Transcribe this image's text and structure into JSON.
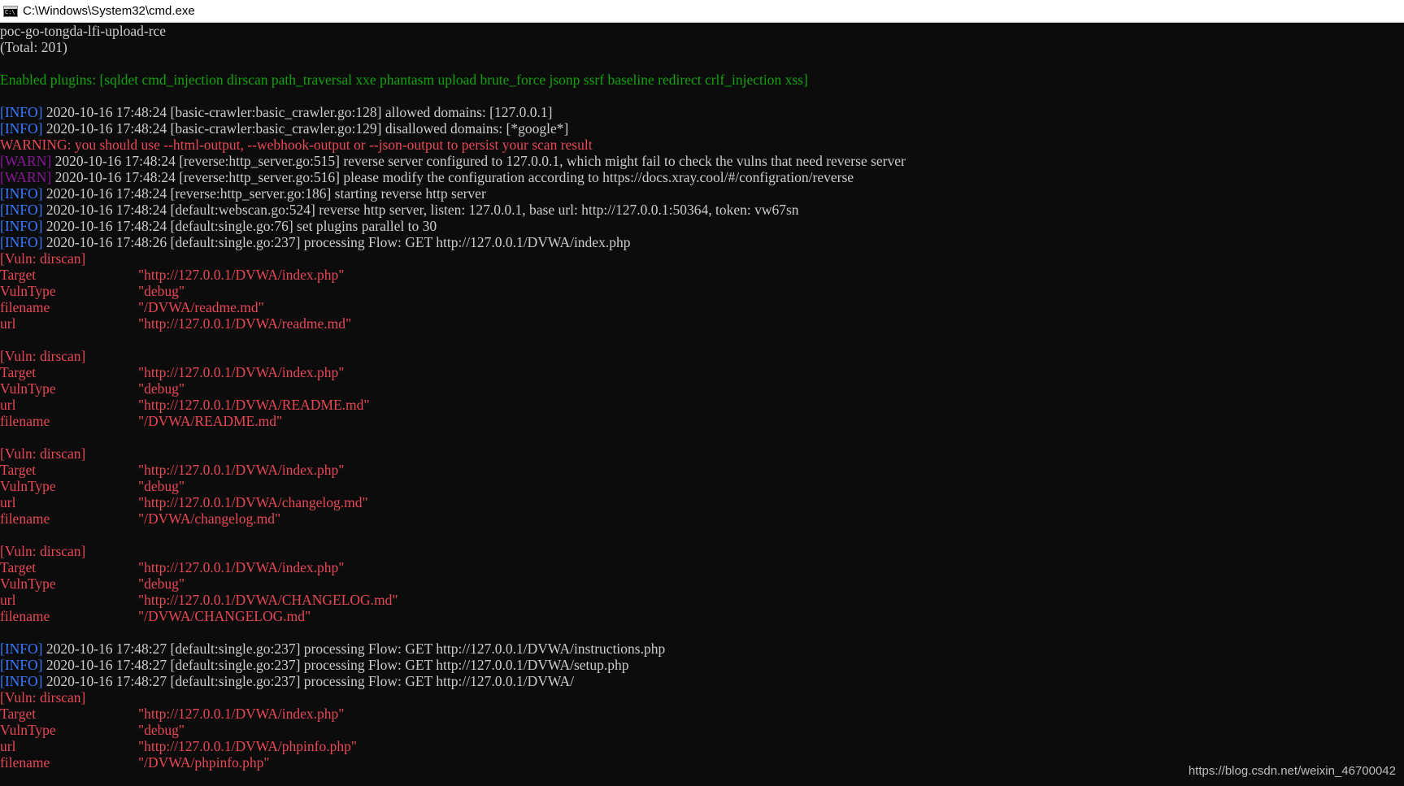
{
  "window": {
    "title": "C:\\Windows\\System32\\cmd.exe"
  },
  "colors": {
    "info": "#3b78ff",
    "warn": "#881798",
    "error": "#e74856",
    "plugins": "#13a10e",
    "text": "#cccccc",
    "background": "#0c0c0c"
  },
  "console": {
    "header": [
      "poc-go-tongda-lfi-upload-rce",
      "(Total: 201)"
    ],
    "plugins_line": "Enabled plugins: [sqldet cmd_injection dirscan path_traversal xxe phantasm upload brute_force jsonp ssrf baseline redirect crlf_injection xss]",
    "logs1": [
      {
        "tag": "[INFO]",
        "level": "info",
        "msg": " 2020-10-16 17:48:24 [basic-crawler:basic_crawler.go:128] allowed domains: [127.0.0.1]"
      },
      {
        "tag": "[INFO]",
        "level": "info",
        "msg": " 2020-10-16 17:48:24 [basic-crawler:basic_crawler.go:129] disallowed domains: [*google*]"
      }
    ],
    "warning": "WARNING: you should use --html-output, --webhook-output or --json-output to persist your scan result",
    "logs2": [
      {
        "tag": "[WARN]",
        "level": "warn",
        "msg": " 2020-10-16 17:48:24 [reverse:http_server.go:515] reverse server configured to 127.0.0.1, which might fail to check the vulns that need reverse server"
      },
      {
        "tag": "[WARN]",
        "level": "warn",
        "msg": " 2020-10-16 17:48:24 [reverse:http_server.go:516] please modify the configuration according to https://docs.xray.cool/#/configration/reverse"
      },
      {
        "tag": "[INFO]",
        "level": "info",
        "msg": " 2020-10-16 17:48:24 [reverse:http_server.go:186] starting reverse http server"
      },
      {
        "tag": "[INFO]",
        "level": "info",
        "msg": " 2020-10-16 17:48:24 [default:webscan.go:524] reverse http server, listen: 127.0.0.1, base url: http://127.0.0.1:50364, token: vw67sn"
      },
      {
        "tag": "[INFO]",
        "level": "info",
        "msg": " 2020-10-16 17:48:24 [default:single.go:76] set plugins parallel to 30"
      },
      {
        "tag": "[INFO]",
        "level": "info",
        "msg": " 2020-10-16 17:48:26 [default:single.go:237] processing Flow: GET http://127.0.0.1/DVWA/index.php"
      }
    ],
    "vulns1": [
      {
        "header": "[Vuln: dirscan]",
        "fields": [
          {
            "key": "Target",
            "val": "\"http://127.0.0.1/DVWA/index.php\""
          },
          {
            "key": "VulnType",
            "val": "\"debug\""
          },
          {
            "key": "filename",
            "val": "\"/DVWA/readme.md\""
          },
          {
            "key": "url",
            "val": "\"http://127.0.0.1/DVWA/readme.md\""
          }
        ]
      },
      {
        "header": "[Vuln: dirscan]",
        "fields": [
          {
            "key": "Target",
            "val": "\"http://127.0.0.1/DVWA/index.php\""
          },
          {
            "key": "VulnType",
            "val": "\"debug\""
          },
          {
            "key": "url",
            "val": "\"http://127.0.0.1/DVWA/README.md\""
          },
          {
            "key": "filename",
            "val": "\"/DVWA/README.md\""
          }
        ]
      },
      {
        "header": "[Vuln: dirscan]",
        "fields": [
          {
            "key": "Target",
            "val": "\"http://127.0.0.1/DVWA/index.php\""
          },
          {
            "key": "VulnType",
            "val": "\"debug\""
          },
          {
            "key": "url",
            "val": "\"http://127.0.0.1/DVWA/changelog.md\""
          },
          {
            "key": "filename",
            "val": "\"/DVWA/changelog.md\""
          }
        ]
      },
      {
        "header": "[Vuln: dirscan]",
        "fields": [
          {
            "key": "Target",
            "val": "\"http://127.0.0.1/DVWA/index.php\""
          },
          {
            "key": "VulnType",
            "val": "\"debug\""
          },
          {
            "key": "url",
            "val": "\"http://127.0.0.1/DVWA/CHANGELOG.md\""
          },
          {
            "key": "filename",
            "val": "\"/DVWA/CHANGELOG.md\""
          }
        ]
      }
    ],
    "logs3": [
      {
        "tag": "[INFO]",
        "level": "info",
        "msg": " 2020-10-16 17:48:27 [default:single.go:237] processing Flow: GET http://127.0.0.1/DVWA/instructions.php"
      },
      {
        "tag": "[INFO]",
        "level": "info",
        "msg": " 2020-10-16 17:48:27 [default:single.go:237] processing Flow: GET http://127.0.0.1/DVWA/setup.php"
      },
      {
        "tag": "[INFO]",
        "level": "info",
        "msg": " 2020-10-16 17:48:27 [default:single.go:237] processing Flow: GET http://127.0.0.1/DVWA/"
      }
    ],
    "vuln5": {
      "header": "[Vuln: dirscan]",
      "fields": [
        {
          "key": "Target",
          "val": "\"http://127.0.0.1/DVWA/index.php\""
        },
        {
          "key": "VulnType",
          "val": "\"debug\""
        },
        {
          "key": "url",
          "val": "\"http://127.0.0.1/DVWA/phpinfo.php\""
        },
        {
          "key": "filename",
          "val": "\"/DVWA/phpinfo.php\""
        }
      ]
    }
  },
  "watermark": "https://blog.csdn.net/weixin_46700042"
}
